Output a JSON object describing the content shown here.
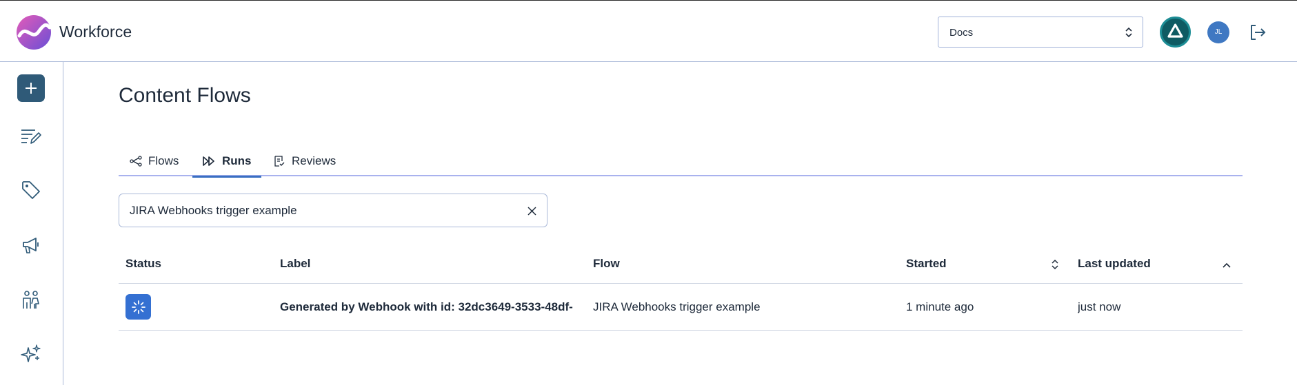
{
  "header": {
    "brand": "Workforce",
    "workspace_select": {
      "selected": "Docs"
    },
    "avatar_initials": "JL"
  },
  "page": {
    "title": "Content Flows"
  },
  "tabs": [
    {
      "label": "Flows",
      "icon": "flow-icon",
      "active": false
    },
    {
      "label": "Runs",
      "icon": "runs-icon",
      "active": true
    },
    {
      "label": "Reviews",
      "icon": "reviews-icon",
      "active": false
    }
  ],
  "search": {
    "value": "JIRA Webhooks trigger example"
  },
  "table": {
    "columns": [
      "Status",
      "Label",
      "Flow",
      "Started",
      "Last updated"
    ],
    "rows": [
      {
        "status": "running",
        "label": "Generated by Webhook with id: 32dc3649-3533-48df-",
        "flow": "JIRA Webhooks trigger example",
        "started": "1 minute ago",
        "last_updated": "just now"
      }
    ]
  },
  "colors": {
    "accent": "#3470d2",
    "sidebar_add": "#2f5a78",
    "tab_indicator": "#3a6fc2",
    "border": "#a9b8d8"
  }
}
